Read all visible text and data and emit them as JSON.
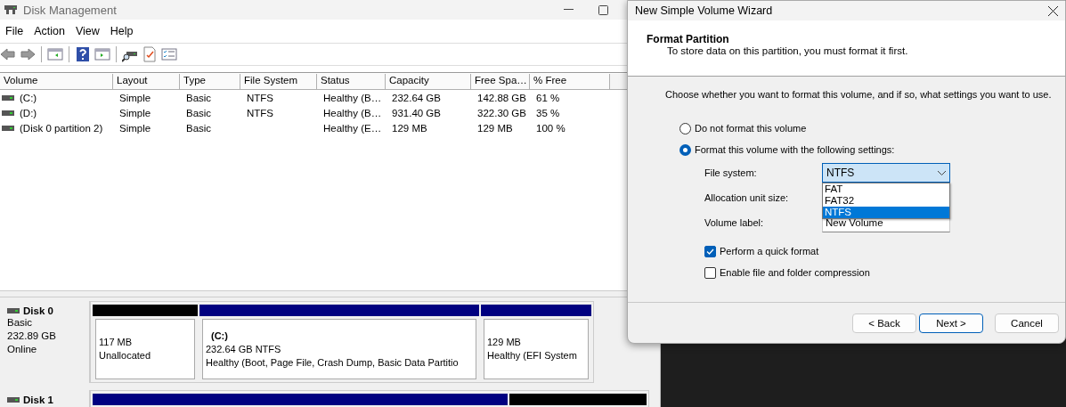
{
  "main_window": {
    "title": "Disk Management",
    "menu": [
      "File",
      "Action",
      "View",
      "Help"
    ],
    "columns": [
      "Volume",
      "Layout",
      "Type",
      "File System",
      "Status",
      "Capacity",
      "Free Spa…",
      "% Free"
    ],
    "rows": [
      {
        "cells": [
          "(C:)",
          "Simple",
          "Basic",
          "NTFS",
          "Healthy (B…",
          "232.64 GB",
          "142.88 GB",
          "61 %"
        ]
      },
      {
        "cells": [
          "(D:)",
          "Simple",
          "Basic",
          "NTFS",
          "Healthy (B…",
          "931.40 GB",
          "322.30 GB",
          "35 %"
        ]
      },
      {
        "cells": [
          "(Disk 0 partition 2)",
          "Simple",
          "Basic",
          "",
          "Healthy (E…",
          "129 MB",
          "129 MB",
          "100 %"
        ]
      }
    ],
    "disks": [
      {
        "name": "Disk 0",
        "lines": [
          "Basic",
          "232.89 GB",
          "Online"
        ],
        "partitions": [
          {
            "kind": "unallocated",
            "size": "117 MB",
            "status": "Unallocated"
          },
          {
            "kind": "primary",
            "title": "(C:)",
            "size": "232.64 GB NTFS",
            "status": "Healthy (Boot, Page File, Crash Dump, Basic Data Partitio"
          },
          {
            "kind": "primary",
            "size": "129 MB",
            "status": "Healthy (EFI System"
          }
        ]
      },
      {
        "name": "Disk 1",
        "partitions": [
          {
            "kind": "primary"
          },
          {
            "kind": "unallocated"
          }
        ]
      }
    ]
  },
  "wizard": {
    "title": "New Simple Volume Wizard",
    "heading": "Format Partition",
    "subheading": "To store data on this partition, you must format it first.",
    "intro": "Choose whether you want to format this volume, and if so, what settings you want to use.",
    "options": [
      {
        "label": "Do not format this volume",
        "selected": false
      },
      {
        "label": "Format this volume with the following settings:",
        "selected": true
      }
    ],
    "file_system": {
      "label": "File system:",
      "value": "NTFS",
      "expanded": true,
      "choices": [
        {
          "label": "FAT",
          "selected": false
        },
        {
          "label": "FAT32",
          "selected": false
        },
        {
          "label": "NTFS",
          "selected": true
        }
      ]
    },
    "allocation_unit_size": {
      "label": "Allocation unit size:"
    },
    "volume_label": {
      "label": "Volume label:",
      "value": "New Volume"
    },
    "checkboxes": [
      {
        "label": "Perform a quick format",
        "checked": true
      },
      {
        "label": "Enable file and folder compression",
        "checked": false
      }
    ],
    "buttons": [
      {
        "label": "< Back",
        "default": false
      },
      {
        "label": "Next >",
        "default": true
      },
      {
        "label": "Cancel",
        "default": false
      }
    ]
  }
}
